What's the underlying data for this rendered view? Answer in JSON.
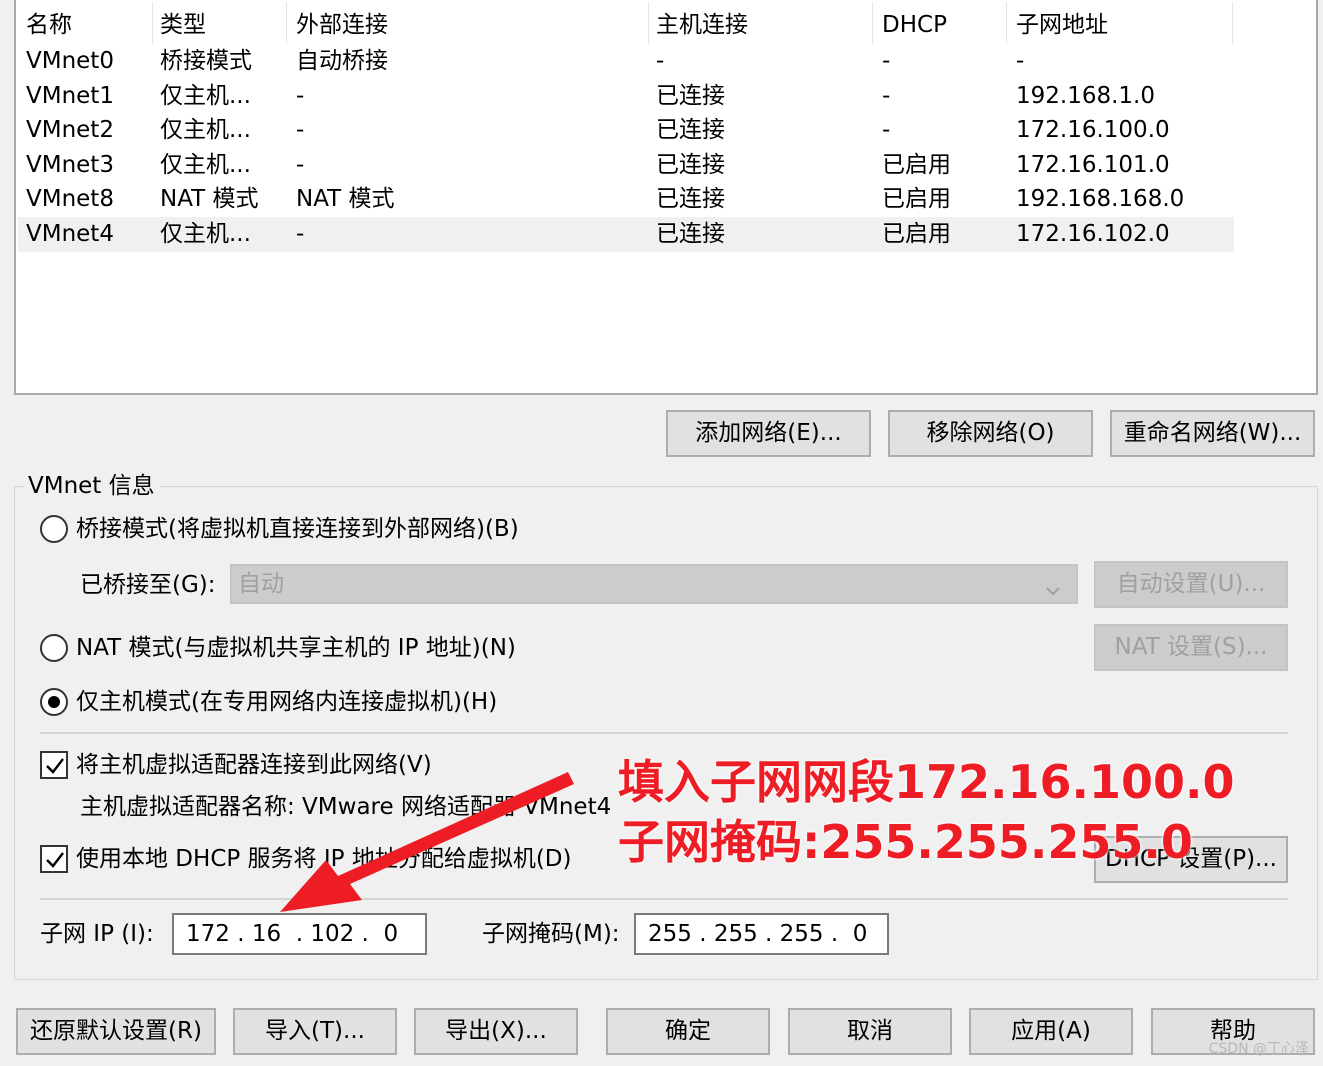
{
  "table": {
    "headers": [
      "名称",
      "类型",
      "外部连接",
      "主机连接",
      "DHCP",
      "子网地址"
    ],
    "rows": [
      [
        "VMnet0",
        "桥接模式",
        "自动桥接",
        "-",
        "-",
        "-"
      ],
      [
        "VMnet1",
        "仅主机...",
        "-",
        "已连接",
        "-",
        "192.168.1.0"
      ],
      [
        "VMnet2",
        "仅主机...",
        "-",
        "已连接",
        "-",
        "172.16.100.0"
      ],
      [
        "VMnet3",
        "仅主机...",
        "-",
        "已连接",
        "已启用",
        "172.16.101.0"
      ],
      [
        "VMnet8",
        "NAT 模式",
        "NAT 模式",
        "已连接",
        "已启用",
        "192.168.168.0"
      ],
      [
        "VMnet4",
        "仅主机...",
        "-",
        "已连接",
        "已启用",
        "172.16.102.0"
      ]
    ]
  },
  "list_buttons": {
    "add": "添加网络(E)...",
    "remove": "移除网络(O)",
    "rename": "重命名网络(W)..."
  },
  "vmnet_info": {
    "title": "VMnet 信息",
    "bridged_radio": "桥接模式(将虚拟机直接连接到外部网络)(B)",
    "bridged_to_label": "已桥接至(G):",
    "bridged_to_value": "自动",
    "auto_settings": "自动设置(U)...",
    "nat_radio": "NAT 模式(与虚拟机共享主机的 IP 地址)(N)",
    "nat_settings": "NAT 设置(S)...",
    "hostonly_radio": "仅主机模式(在专用网络内连接虚拟机)(H)",
    "connect_adapter_check": "将主机虚拟适配器连接到此网络(V)",
    "adapter_name": "主机虚拟适配器名称: VMware 网络适配器 VMnet4",
    "dhcp_check": "使用本地 DHCP 服务将 IP 地址分配给虚拟机(D)",
    "dhcp_settings": "DHCP 设置(P)...",
    "subnet_ip_label": "子网 IP (I):",
    "subnet_ip_value": "172 . 16  . 102 .  0",
    "subnet_mask_label": "子网掩码(M):",
    "subnet_mask_value": "255 . 255 . 255 .  0"
  },
  "bottom_buttons": {
    "restore": "还原默认设置(R)",
    "import": "导入(T)...",
    "export": "导出(X)...",
    "ok": "确定",
    "cancel": "取消",
    "apply": "应用(A)",
    "help": "帮助"
  },
  "annotation": {
    "line1": "填入子网网段172.16.100.0",
    "line2": "子网掩码:255.255.255.0",
    "color": "#ee1c25"
  },
  "watermark": "CSDN @丁心泽"
}
